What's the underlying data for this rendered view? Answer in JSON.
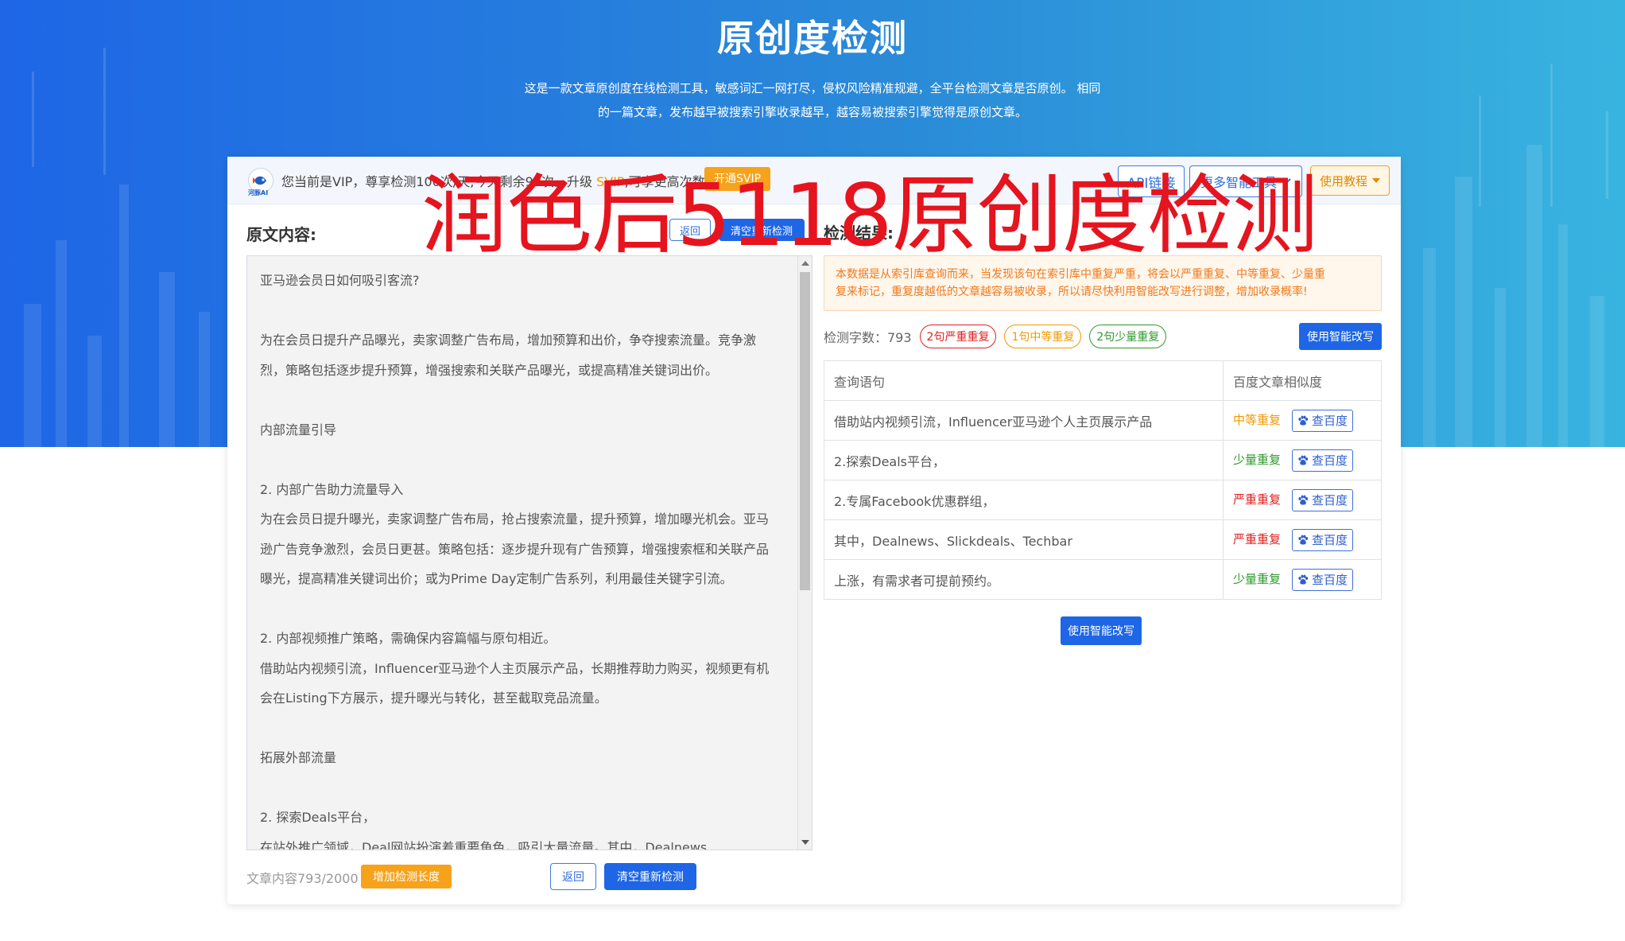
{
  "header": {
    "title": "原创度检测",
    "description_line1": "这是一款文章原创度在线检测工具，敏感词汇一网打尽，侵权风险精准规避，全平台检测文章是否原创。 相同",
    "description_line2": "的一篇文章，发布越早被搜索引擎收录越早，越容易被搜索引擎觉得是原创文章。"
  },
  "topbar": {
    "logo_text": "河豚AI",
    "vip_prefix": "您当前是VIP，尊享检测100次/天;今天剩余98次。升级 ",
    "vip_svip": "SVIP",
    "vip_suffix": ",可享更高次数",
    "open_svip_label": "开通SVIP",
    "api_label": "API链接",
    "more_tools_label": "更多智能工具",
    "tutorial_label": "使用教程"
  },
  "left": {
    "label": "原文内容:",
    "mini_back_label": "返回",
    "mini_clear_label": "清空重新检测",
    "paragraphs": [
      "亚马逊会员日如何吸引客流?",
      "",
      "为在会员日提升产品曝光，卖家调整广告布局，增加预算和出价，争夺搜索流量。竞争激",
      "烈，策略包括逐步提升预算，增强搜索和关联产品曝光，或提高精准关键词出价。",
      "",
      "内部流量引导",
      "",
      "2. 内部广告助力流量导入",
      "为在会员日提升曝光，卖家调整广告布局，抢占搜索流量，提升预算，增加曝光机会。亚马",
      "逊广告竞争激烈，会员日更甚。策略包括：逐步提升现有广告预算，增强搜索框和关联产品",
      "曝光，提高精准关键词出价；或为Prime Day定制广告系列，利用最佳关键字引流。",
      "",
      "2. 内部视频推广策略，需确保内容篇幅与原句相近。",
      "借助站内视频引流，Influencer亚马逊个人主页展示产品，长期推荐助力购买，视频更有机",
      "会在Listing下方展示，提升曝光与转化，甚至截取竞品流量。",
      "",
      "拓展外部流量",
      "",
      "2. 探索Deals平台，",
      "在站外推广领域，Deal网站扮演着重要角色，吸引大量流量。其中，Dealnews"
    ],
    "footer_count": "文章内容793/2000",
    "increase_label": "增加检测长度",
    "back_label": "返回",
    "clear_label": "清空重新检测"
  },
  "right": {
    "label": "检测结果:",
    "notice_line1": "本数据是从索引库查询而来，当发现该句在索引库中重复严重，将会以严重重复、中等重复、少量重",
    "notice_line2": "复来标记，重复度越低的文章越容易被收录，所以请尽快利用智能改写进行调整，增加收录概率!",
    "word_count_label": "检测字数：793",
    "severe_pill": "2句严重重复",
    "medium_pill": "1句中等重复",
    "minor_pill": "2句少量重复",
    "rewrite_label": "使用智能改写",
    "table_headers": [
      "查询语句",
      "百度文章相似度"
    ],
    "rows": [
      {
        "query": "借助站内视频引流，Influencer亚马逊个人主页展示产品",
        "level": "中等重复",
        "action": "查百度"
      },
      {
        "query": "2.探索Deals平台，",
        "level": "少量重复",
        "action": "查百度"
      },
      {
        "query": "2.专属Facebook优惠群组，",
        "level": "严重重复",
        "action": "查百度"
      },
      {
        "query": "其中，Dealnews、Slickdeals、Techbar",
        "level": "严重重复",
        "action": "查百度"
      },
      {
        "query": "上涨，有需求者可提前预约。",
        "level": "少量重复",
        "action": "查百度"
      }
    ],
    "rewrite_bottom_label": "使用智能改写"
  },
  "overlay_text": "润色后5118原创度检测",
  "colors": {
    "primary": "#1e66e6",
    "severe": "#e02020",
    "medium": "#f39800",
    "minor": "#2e9a2e",
    "overlay": "#e5141e"
  }
}
